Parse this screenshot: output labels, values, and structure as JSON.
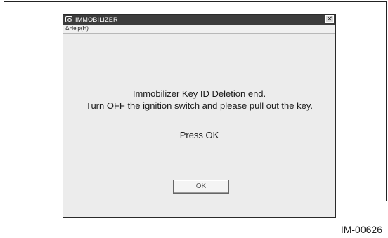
{
  "window": {
    "title": "IMMOBILIZER",
    "close_glyph": "✕",
    "icons": {
      "app": "app-icon",
      "close": "close-icon"
    }
  },
  "menubar": {
    "items": [
      {
        "label": "&Help(H)"
      }
    ]
  },
  "message": {
    "line1": "Immobilizer Key ID Deletion end.",
    "line2": "Turn OFF the ignition switch and please pull out the key.",
    "line3": "Press OK"
  },
  "buttons": {
    "ok_label": "OK"
  },
  "figure": {
    "id": "IM-00626"
  },
  "colors": {
    "titlebar": "#3c3c3c",
    "window_bg": "#ececec",
    "text": "#1a1a1a"
  }
}
